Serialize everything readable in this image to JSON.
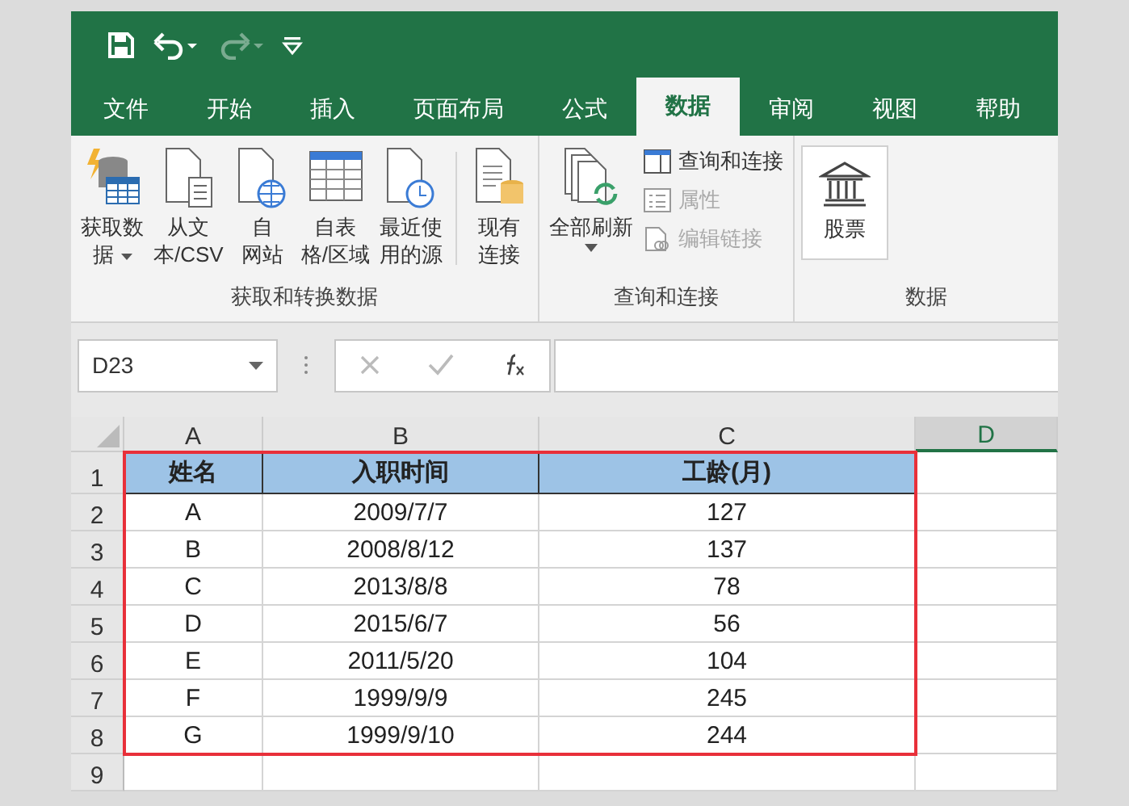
{
  "quick_access": [
    {
      "kind": "save",
      "disabled": false
    },
    {
      "kind": "undo",
      "disabled": false
    },
    {
      "kind": "redo",
      "disabled": true
    },
    {
      "kind": "customize",
      "disabled": false
    }
  ],
  "tabs": [
    {
      "label": "文件",
      "selected": false
    },
    {
      "label": "开始",
      "selected": false
    },
    {
      "label": "插入",
      "selected": false
    },
    {
      "label": "页面布局",
      "selected": false
    },
    {
      "label": "公式",
      "selected": false
    },
    {
      "label": "数据",
      "selected": true
    },
    {
      "label": "审阅",
      "selected": false
    },
    {
      "label": "视图",
      "selected": false
    },
    {
      "label": "帮助",
      "selected": false
    }
  ],
  "ribbon_groups": [
    {
      "label": "获取和转换数据",
      "buttons": [
        {
          "kind": "get-data",
          "lines": [
            "获取数",
            "据"
          ],
          "dropdown": true
        },
        {
          "kind": "text-csv",
          "lines": [
            "从文",
            "本/CSV"
          ],
          "dropdown": false
        },
        {
          "kind": "web",
          "lines": [
            "自",
            "网站"
          ],
          "dropdown": false
        },
        {
          "kind": "table-range",
          "lines": [
            "自表",
            "格/区域"
          ],
          "dropdown": false
        },
        {
          "kind": "recent",
          "lines": [
            "最近使",
            "用的源"
          ],
          "dropdown": false
        },
        {
          "kind": "existing",
          "lines": [
            "现有",
            "连接"
          ],
          "dropdown": false
        }
      ]
    },
    {
      "label": "查询和连接",
      "buttons": [
        {
          "kind": "refresh",
          "lines": [
            "全部刷新"
          ],
          "dropdown": true
        }
      ],
      "small_buttons": [
        {
          "kind": "queries",
          "label": "查询和连接",
          "disabled": false
        },
        {
          "kind": "properties",
          "label": "属性",
          "disabled": true
        },
        {
          "kind": "links",
          "label": "编辑链接",
          "disabled": true
        }
      ]
    },
    {
      "label": "数据",
      "buttons": [
        {
          "kind": "stocks",
          "lines": [
            "股票"
          ]
        }
      ]
    }
  ],
  "name_box": "D23",
  "columns": [
    {
      "label": "A",
      "selected": false
    },
    {
      "label": "B",
      "selected": false
    },
    {
      "label": "C",
      "selected": false
    },
    {
      "label": "D",
      "selected": true
    }
  ],
  "table": {
    "header": [
      "姓名",
      "入职时间",
      "工龄(月)"
    ],
    "rows": [
      [
        "A",
        "2009/7/7",
        "127"
      ],
      [
        "B",
        "2008/8/12",
        "137"
      ],
      [
        "C",
        "2013/8/8",
        "78"
      ],
      [
        "D",
        "2015/6/7",
        "56"
      ],
      [
        "E",
        "2011/5/20",
        "104"
      ],
      [
        "F",
        "1999/9/9",
        "245"
      ],
      [
        "G",
        "1999/9/10",
        "244"
      ]
    ]
  },
  "row_numbers": [
    "1",
    "2",
    "3",
    "4",
    "5",
    "6",
    "7",
    "8",
    "9"
  ]
}
